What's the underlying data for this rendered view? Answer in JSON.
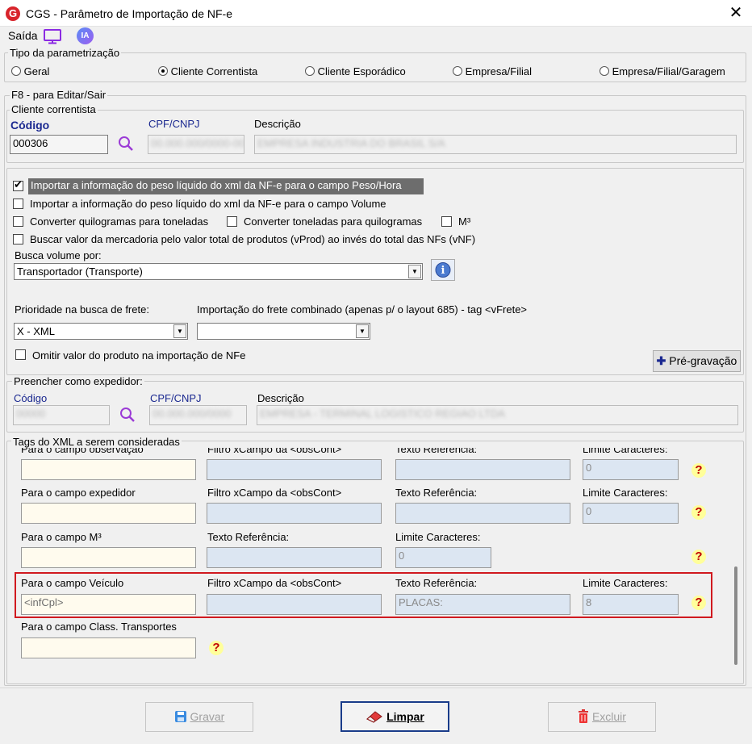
{
  "window": {
    "title": "CGS - Parâmetro de Importação de NF-e",
    "close": "✕"
  },
  "toolbar": {
    "saida": "Saída",
    "ia": "IA"
  },
  "tipo": {
    "legend": "Tipo da parametrização",
    "options": [
      "Geral",
      "Cliente Correntista",
      "Cliente Esporádico",
      "Empresa/Filial",
      "Empresa/Filial/Garagem"
    ],
    "selected": "Cliente Correntista"
  },
  "f8": {
    "legend": "F8 - para Editar/Sair"
  },
  "cliente": {
    "legend": "Cliente correntista",
    "codigo_label": "Código",
    "codigo_value": "000306",
    "cpf_label": "CPF/CNPJ",
    "cpf_value": "00.000.000/0000-00",
    "descricao_label": "Descrição",
    "descricao_value": "EMPRESA INDUSTRIA DO BRASIL S/A"
  },
  "opcoes": {
    "peso_hora": "Importar a informação do peso líquido do xml da NF-e para o campo Peso/Hora",
    "peso_volume": "Importar a informação do peso líquido do xml da NF-e para o campo Volume",
    "kg_ton": "Converter quilogramas para toneladas",
    "ton_kg": "Converter toneladas para quilogramas",
    "m3": "M³",
    "vprod": "Buscar valor da mercadoria pelo valor total de produtos (vProd) ao invés do total das NFs (vNF)",
    "busca_volume_label": "Busca volume por:",
    "busca_volume_value": "Transportador (Transporte)",
    "prioridade_label": "Prioridade na busca de frete:",
    "prioridade_value": "X - XML",
    "frete_label": "Importação do frete combinado (apenas p/ o layout 685) - tag <vFrete>",
    "frete_value": "",
    "omitir": "Omitir valor do produto na importação de NFe",
    "pre_gravacao": "Pré-gravação"
  },
  "expedidor": {
    "legend": "Preencher como expedidor:",
    "codigo_label": "Código",
    "codigo_value": "00000",
    "cpf_label": "CPF/CNPJ",
    "cpf_value": "00.000.000/0000",
    "descricao_label": "Descrição",
    "descricao_value": "EMPRESA - TERMINAL LOGISTICO REGIAO LTDA"
  },
  "tags": {
    "legend": "Tags do XML a serem consideradas",
    "row0": {
      "campo": "Para o campo observação",
      "filtro": "Filtro xCampo da <obsCont>",
      "texto": "Texto Referência:",
      "limite": "Limite Caracteres:",
      "limite_value": "0"
    },
    "row1": {
      "campo": "Para o campo expedidor",
      "filtro": "Filtro xCampo da <obsCont>",
      "texto": "Texto Referência:",
      "limite": "Limite Caracteres:",
      "limite_value": "0"
    },
    "row2": {
      "campo": "Para o campo M³",
      "texto": "Texto Referência:",
      "limite": "Limite Caracteres:",
      "limite_value": "0"
    },
    "row3": {
      "campo": "Para o campo Veículo",
      "campo_value": "<infCpl>",
      "filtro": "Filtro xCampo da <obsCont>",
      "texto": "Texto Referência:",
      "texto_value": "PLACAS:",
      "limite": "Limite Caracteres:",
      "limite_value": "8"
    },
    "row4": {
      "campo": "Para o campo Class. Transportes"
    },
    "help": "?"
  },
  "footer": {
    "gravar": "Gravar",
    "limpar": "Limpar",
    "excluir": "Excluir"
  },
  "colors": {
    "accent_blue": "#1a2890",
    "highlight_red": "#d0191f",
    "field_yellow": "#fffbee",
    "field_blue": "#dce6f2"
  }
}
